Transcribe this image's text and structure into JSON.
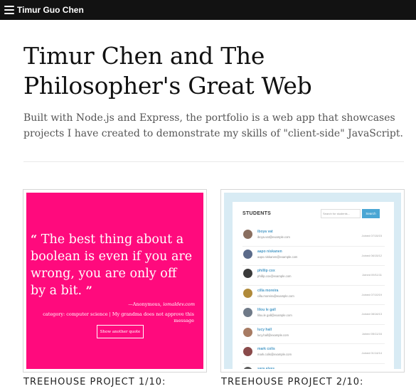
{
  "nav": {
    "brand": "Timur Guo Chen"
  },
  "hero": {
    "title": "Timur Chen and The Philosopher's Great Web",
    "subtitle": "Built with Node.js and Express, the portfolio is a web app that showcases projects I have created to demonstrate my skills of \"client-side\" JavaScript."
  },
  "projects": [
    {
      "label": "TREEHOUSE PROJECT 1/10:",
      "quote": {
        "open_mark": "“",
        "text": "The best thing about a boolean is even if you are wrong, you are only off by a bit.",
        "close_mark": "”",
        "author_prefix": "—Anonymous, ",
        "author_source": "iomaldev.com",
        "category": "category: computer science | My grandma does not approve this message",
        "button": "Show another quote",
        "bg_color": "#ff0a7d"
      }
    },
    {
      "label": "TREEHOUSE PROJECT 2/10:",
      "students": {
        "heading": "STUDENTS",
        "search_placeholder": "Search for students...",
        "search_button": "Search",
        "rows": [
          {
            "name": "iboya vat",
            "email": "iboya.vat@example.com",
            "joined": "Joined 07/15/15"
          },
          {
            "name": "aapo niskanen",
            "email": "aapo.niskanen@example.com",
            "joined": "Joined 06/15/12"
          },
          {
            "name": "phillip cox",
            "email": "phillip.cox@example.com",
            "joined": "Joined 09/11/11"
          },
          {
            "name": "cilla moreira",
            "email": "cilla.moreira@example.com",
            "joined": "Joined 07/10/19"
          },
          {
            "name": "lilou le gall",
            "email": "lilou.le gall@example.com",
            "joined": "Joined 08/16/13"
          },
          {
            "name": "lucy hall",
            "email": "lucy.hall@example.com",
            "joined": "Joined 05/11/16"
          },
          {
            "name": "mark colis",
            "email": "mark.colis@example.com",
            "joined": "Joined 01/14/14"
          },
          {
            "name": "sara alves",
            "email": "sara.alves@example.com",
            "joined": "Joined 07/16/18"
          }
        ]
      }
    }
  ]
}
